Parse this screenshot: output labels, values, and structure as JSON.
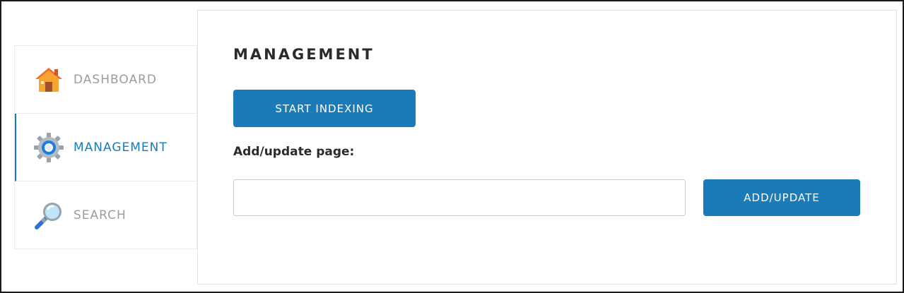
{
  "sidebar": {
    "items": [
      {
        "label": "DASHBOARD",
        "icon": "house-icon",
        "active": false
      },
      {
        "label": "MANAGEMENT",
        "icon": "gear-icon",
        "active": true
      },
      {
        "label": "SEARCH",
        "icon": "magnifier-icon",
        "active": false
      }
    ]
  },
  "main": {
    "title": "MANAGEMENT",
    "start_button_label": "START INDEXING",
    "field_label": "Add/update page:",
    "input_value": "",
    "input_placeholder": "",
    "add_button_label": "ADD/UPDATE"
  },
  "colors": {
    "accent": "#1b7bb8",
    "inactive_text": "#9c9c9c",
    "heading_text": "#2b2b2b"
  }
}
